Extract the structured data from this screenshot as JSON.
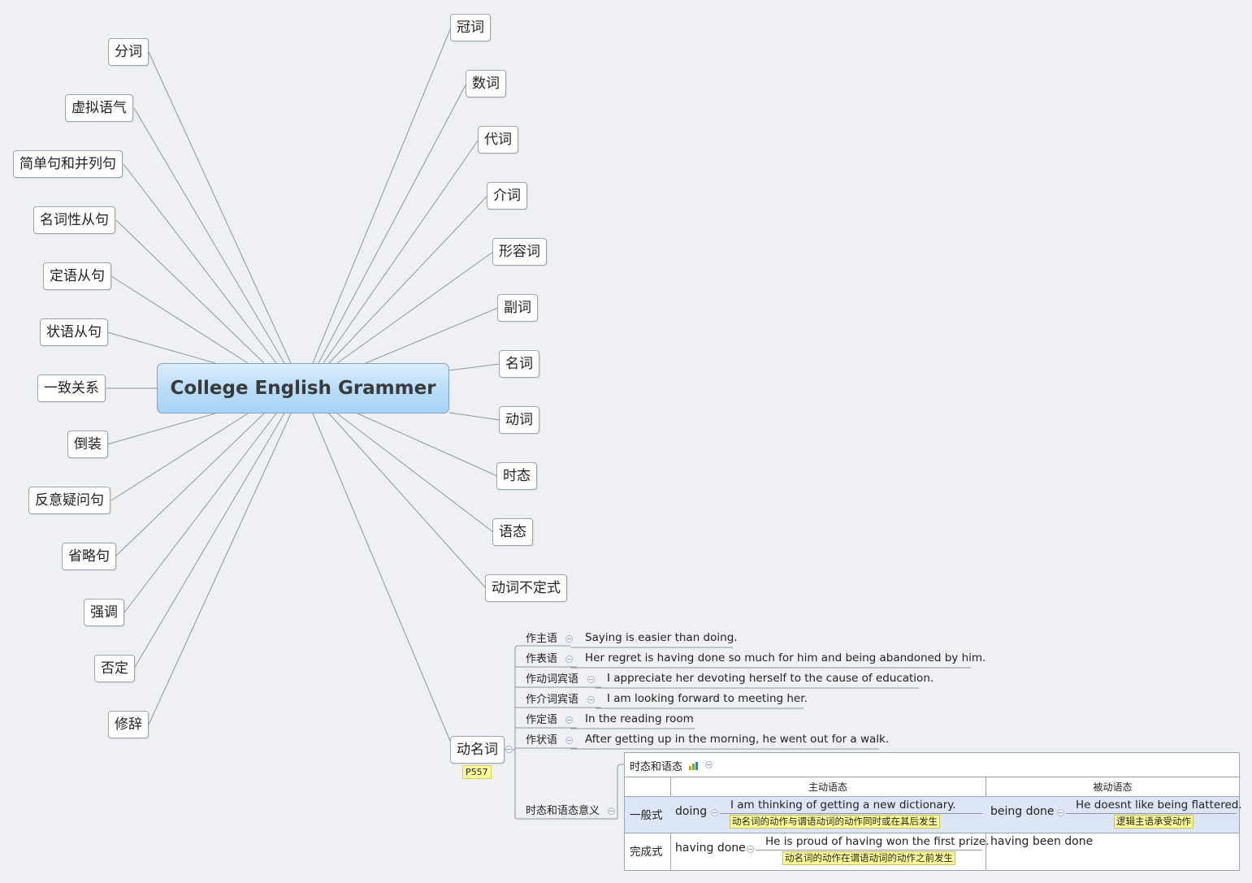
{
  "central": {
    "title": "College English Grammer"
  },
  "left_branches": [
    "分词",
    "虚拟语气",
    "简单句和并列句",
    "名词性从句",
    "定语从句",
    "状语从句",
    "一致关系",
    "倒装",
    "反意疑问句",
    "省略句",
    "强调",
    "否定",
    "修辞"
  ],
  "right_branches": [
    "冠词",
    "数词",
    "代词",
    "介词",
    "形容词",
    "副词",
    "名词",
    "动词",
    "时态",
    "语态",
    "动词不定式"
  ],
  "gerund": {
    "label": "动名词",
    "page_tag": "P557",
    "children": [
      {
        "label": "作主语",
        "example": "Saying is easier than doing."
      },
      {
        "label": "作表语",
        "example": "Her regret is having done so much for him and being abandoned by him."
      },
      {
        "label": "作动词宾语",
        "example": "I appreciate her devoting herself to the cause of education."
      },
      {
        "label": "作介词宾语",
        "example": "I am looking forward to meeting her."
      },
      {
        "label": "作定语",
        "example": "In the reading room"
      },
      {
        "label": "作状语",
        "example": "After getting up in the morning, he went out for a walk."
      }
    ],
    "tense_voice": {
      "label": "时态和语态意义",
      "table_title": "时态和语态",
      "col_active": "主动语态",
      "col_passive": "被动语态",
      "rows": [
        {
          "name": "一般式",
          "active": "doing",
          "active_example": "I am thinking of getting a new dictionary.",
          "active_note": "动名词的动作与谓语动词的动作同时或在其后发生",
          "passive": "being done",
          "passive_example": "He doesnt like being flattered.",
          "passive_note": "逻辑主语承受动作"
        },
        {
          "name": "完成式",
          "active": "having done",
          "active_example": "He is proud of having won the first prize.",
          "active_note": "动名词的动作在谓语动词的动作之前发生",
          "passive": "having been done"
        }
      ]
    }
  },
  "colors": {
    "line": "#8d96a0",
    "highlight_row": "#dde6f7",
    "note_bg": "#ffff99",
    "central_gradient_top": "#dbeefd",
    "central_gradient_bottom": "#a8d3f5"
  }
}
